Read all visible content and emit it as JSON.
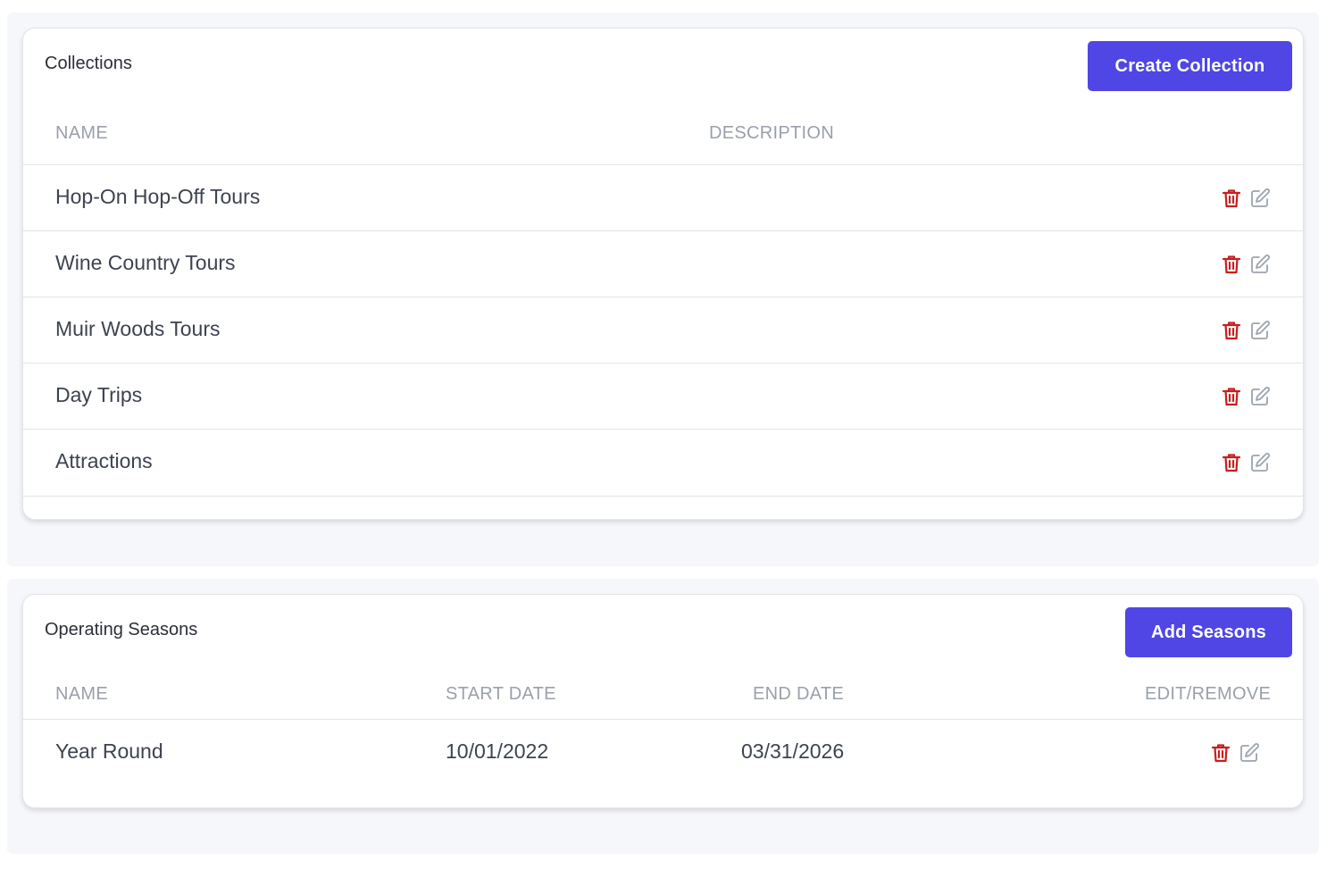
{
  "collections": {
    "title": "Collections",
    "create_button": "Create Collection",
    "columns": [
      "NAME",
      "DESCRIPTION"
    ],
    "rows": [
      {
        "name": "Hop-On Hop-Off Tours",
        "description": ""
      },
      {
        "name": "Wine Country Tours",
        "description": ""
      },
      {
        "name": "Muir Woods Tours",
        "description": ""
      },
      {
        "name": "Day Trips",
        "description": ""
      },
      {
        "name": "Attractions",
        "description": ""
      }
    ]
  },
  "seasons": {
    "title": "Operating Seasons",
    "add_button": "Add Seasons",
    "columns": [
      "NAME",
      "START DATE",
      "END DATE",
      "EDIT/REMOVE"
    ],
    "rows": [
      {
        "name": "Year Round",
        "start_date": "10/01/2022",
        "end_date": "03/31/2026"
      }
    ]
  },
  "icons": {
    "delete": "trash-icon",
    "edit": "edit-icon"
  },
  "colors": {
    "accent": "#4f46e5",
    "delete": "#c81e1e",
    "edit": "#9ca3af"
  }
}
